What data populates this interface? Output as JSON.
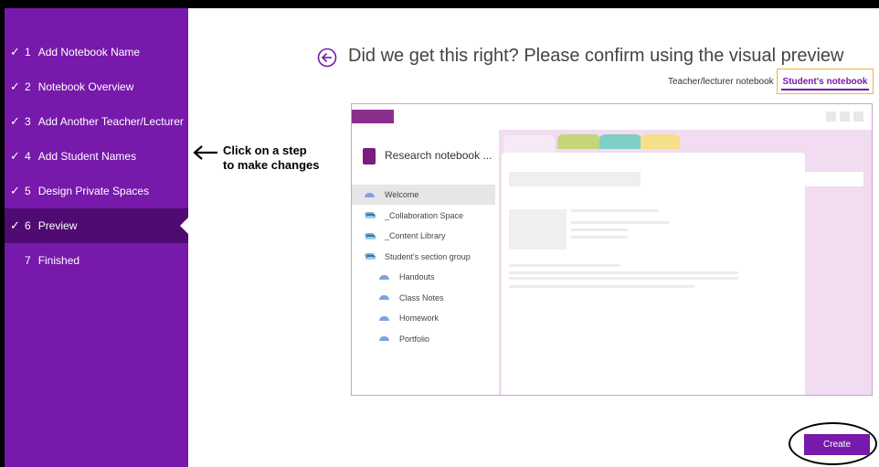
{
  "steps": [
    {
      "num": "1",
      "label": "Add Notebook Name",
      "done": true
    },
    {
      "num": "2",
      "label": "Notebook Overview",
      "done": true
    },
    {
      "num": "3",
      "label": "Add Another Teacher/Lecturer",
      "done": true
    },
    {
      "num": "4",
      "label": "Add Student Names",
      "done": true
    },
    {
      "num": "5",
      "label": "Design Private Spaces",
      "done": true
    },
    {
      "num": "6",
      "label": "Preview",
      "done": true,
      "active": true
    },
    {
      "num": "7",
      "label": "Finished",
      "done": false
    }
  ],
  "check_glyph": "✓",
  "annotation": {
    "line1": "Click on a step",
    "line2": "to make changes"
  },
  "header": {
    "title": "Did we get this right? Please confirm using the visual preview",
    "back_icon": "back-arrow-circle-icon"
  },
  "view_tabs": {
    "teacher": "Teacher/lecturer notebook",
    "student": "Student's notebook",
    "selected": "student"
  },
  "preview": {
    "notebook_name": "Research notebook ...",
    "sections": [
      {
        "label": "Welcome",
        "kind": "page",
        "indent": 0,
        "selected": true
      },
      {
        "label": "_Collaboration Space",
        "kind": "group",
        "indent": 0
      },
      {
        "label": "_Content Library",
        "kind": "group",
        "indent": 0
      },
      {
        "label": "Student's section group",
        "kind": "group",
        "indent": 0
      },
      {
        "label": "Handouts",
        "kind": "page",
        "indent": 1
      },
      {
        "label": "Class Notes",
        "kind": "page",
        "indent": 1
      },
      {
        "label": "Homework",
        "kind": "page",
        "indent": 1
      },
      {
        "label": "Portfolio",
        "kind": "page",
        "indent": 1
      }
    ],
    "tab_colors": [
      "#c3d67a",
      "#7fcfc5",
      "#f5df8a"
    ],
    "accent_color": "#8b2f8e"
  },
  "create_button": {
    "label": "Create"
  },
  "colors": {
    "sidebar": "#7719aa",
    "sidebar_active": "#4f0b72",
    "accent": "#7719aa",
    "highlight_border": "#f0b442"
  }
}
